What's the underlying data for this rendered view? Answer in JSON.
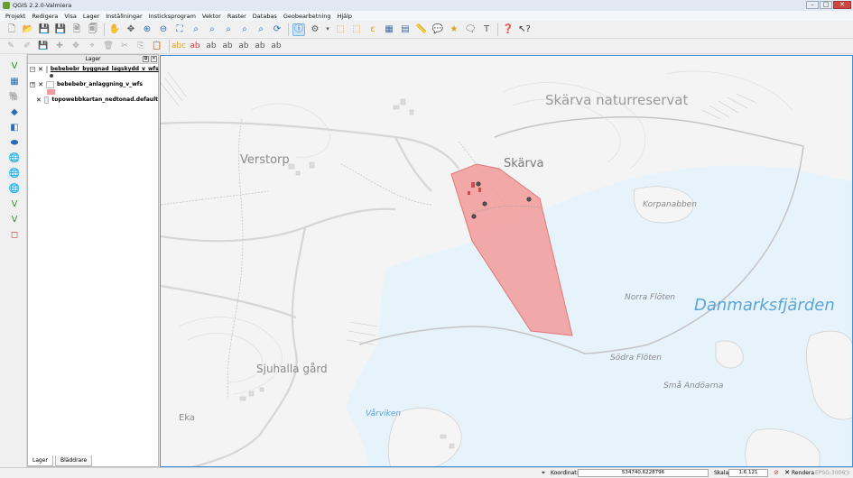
{
  "window": {
    "title": "QGIS 2.2.0-Valmiera"
  },
  "menu": [
    "Projekt",
    "Redigera",
    "Visa",
    "Lager",
    "Inställningar",
    "Insticksprogram",
    "Vektor",
    "Raster",
    "Databas",
    "Geobearbetning",
    "Hjälp"
  ],
  "layers_panel": {
    "title": "Lager",
    "layers": [
      {
        "name": "bebebebr_byggnad_lagskydd_v_wfs",
        "visible": true,
        "expanded": true
      },
      {
        "name": "bebebebr_anlaggning_v_wfs",
        "visible": true,
        "expanded": true
      },
      {
        "name": "topowebbkartan_nedtonad.default",
        "visible": true,
        "expanded": false
      }
    ],
    "tabs": [
      "Lager",
      "Bläddrare"
    ]
  },
  "map": {
    "labels": {
      "skarva_nr": "Skärva naturreservat",
      "verstorp": "Verstorp",
      "skarva": "Skärva",
      "korpanabben": "Korpanabben",
      "danmarksfjarden": "Danmarksfjärden",
      "norra_floten": "Norra Flöten",
      "sodra_floten": "Södra Flöten",
      "sma_andoarna": "Små Andöarna",
      "sjuhalla": "Sjuhalla gård",
      "varviken": "Vårviken",
      "eka": "Eka"
    },
    "colors": {
      "water": "#e6f3fb",
      "land": "#f5f5f5",
      "polygon_fill": "#f29a9a",
      "polygon_stroke": "#e07878",
      "accent": "#3a8fd6"
    }
  },
  "status": {
    "coordinate_label": "Koordinat:",
    "coordinate_value": "534740,6228796",
    "scale_label": "Skala",
    "scale_value": "1:6 121",
    "render_label": "Rendera",
    "crs": "EPSG:3006"
  }
}
